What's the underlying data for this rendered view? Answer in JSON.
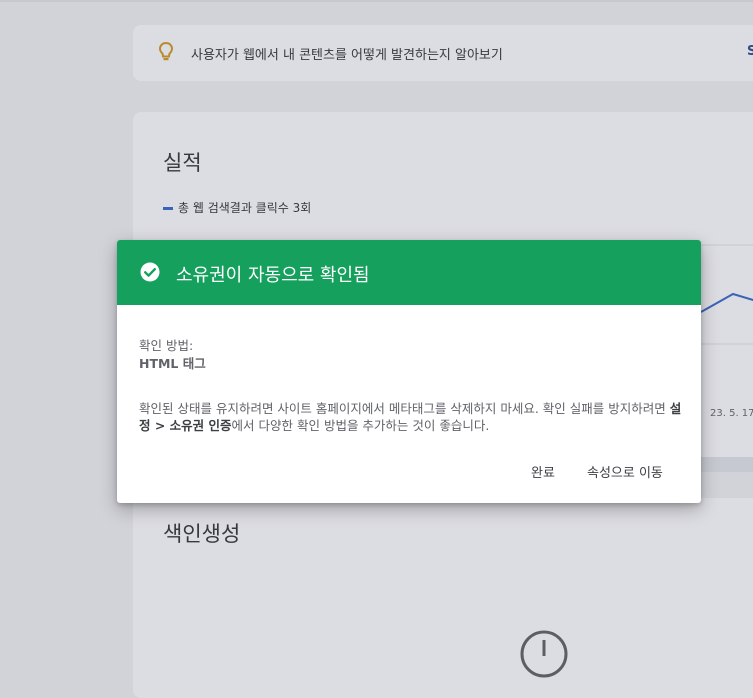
{
  "tip": {
    "text": "사용자가 웹에서 내 콘텐츠를 어떻게 발견하는지 알아보기",
    "link_label": "S",
    "icon": "lightbulb-icon"
  },
  "performance": {
    "title": "실적",
    "legend_label": "총 웹 검색결과 클릭수 3회",
    "date_tick": "23. 5. 17."
  },
  "chart_data": {
    "type": "line",
    "series": [
      {
        "name": "총 웹 검색결과 클릭수 3회",
        "color": "#3b63b8"
      }
    ],
    "x_tick_visible": "23. 5. 17."
  },
  "indexing": {
    "title": "색인생성",
    "icon": "clock-icon"
  },
  "dialog": {
    "title": "소유권이 자동으로 확인됨",
    "header_color": "#16a05d",
    "method_label": "확인 방법:",
    "method_value": "HTML 태그",
    "body_prefix": "확인된 상태를 유지하려면 사이트 홈페이지에서 메타태그를 삭제하지 마세요. 확인 실패를 방지하려면 ",
    "body_bold": "설정 > 소유권 인증",
    "body_suffix": "에서 다양한 확인 방법을 추가하는 것이 좋습니다.",
    "done_label": "완료",
    "go_label": "속성으로 이동"
  }
}
